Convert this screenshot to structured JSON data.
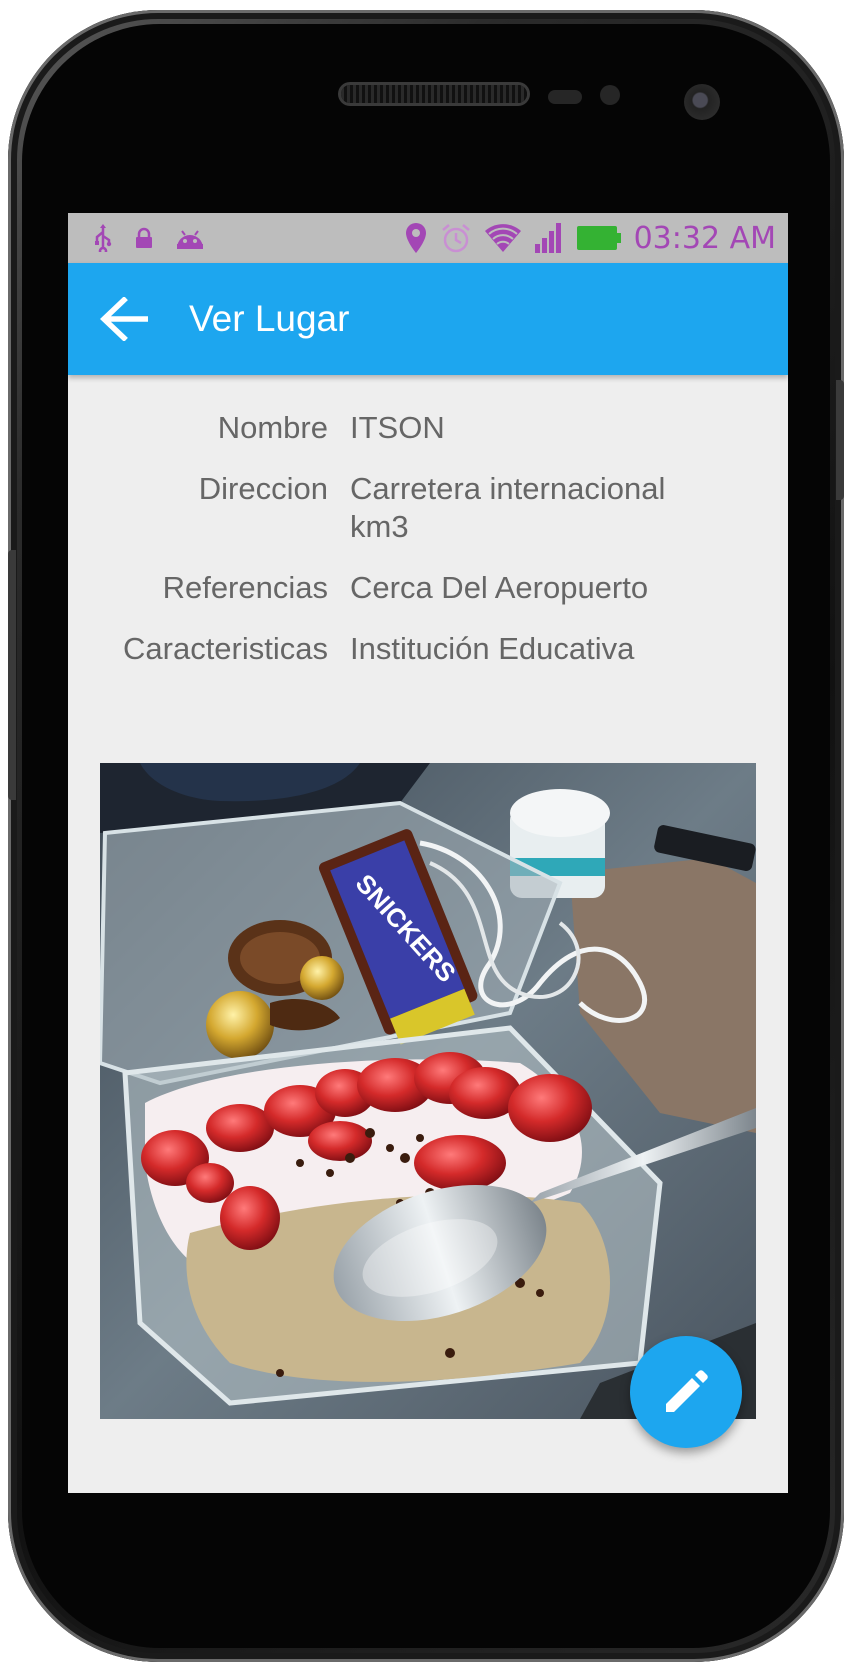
{
  "status_bar": {
    "time": "03:32 AM",
    "icons_left": [
      "usb-icon",
      "lock-icon",
      "android-icon"
    ],
    "icons_right": [
      "location-icon",
      "alarm-icon",
      "wifi-icon",
      "signal-icon",
      "battery-icon"
    ],
    "icon_color": "#a347b5"
  },
  "app_bar": {
    "title": "Ver Lugar",
    "back_icon": "arrow-back-icon",
    "color": "#1da6ef"
  },
  "details": [
    {
      "label": "Nombre",
      "value": "ITSON"
    },
    {
      "label": "Direccion",
      "value": "Carretera internacional km3"
    },
    {
      "label": "Referencias",
      "value": "Cerca Del Aeropuerto"
    },
    {
      "label": "Caracteristicas",
      "value": "Institución Educativa"
    }
  ],
  "photo": {
    "wrapper_text": "SNICKERS"
  },
  "fab": {
    "icon": "pencil-icon",
    "color": "#1da6ef"
  }
}
